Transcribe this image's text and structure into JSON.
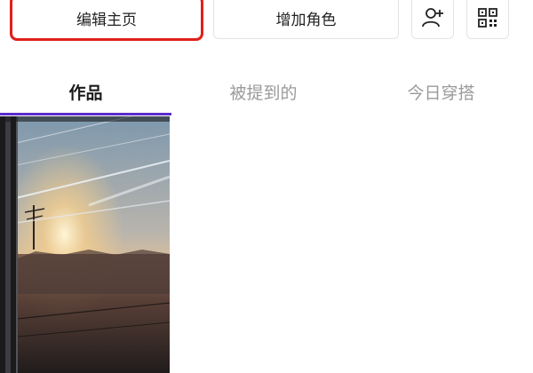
{
  "actions": {
    "edit_profile": "编辑主页",
    "add_role": "增加角色",
    "add_friend_icon": "user-plus-icon",
    "qr_code_icon": "qr-code-icon"
  },
  "tabs": [
    {
      "label": "作品",
      "active": true
    },
    {
      "label": "被提到的",
      "active": false
    },
    {
      "label": "今日穿搭",
      "active": false
    }
  ],
  "colors": {
    "highlight": "#e0201b",
    "tab_indicator": "#5b2cc9",
    "inactive_tab": "#9a9a9a"
  },
  "grid": {
    "items": [
      {
        "kind": "photo",
        "subject": "sunset-through-train-window"
      }
    ]
  }
}
